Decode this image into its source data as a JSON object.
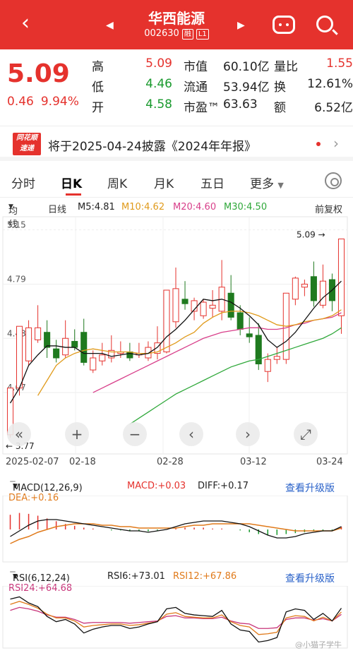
{
  "header": {
    "name": "华西能源",
    "code": "002630",
    "tags": [
      "融",
      "L1"
    ]
  },
  "quote": {
    "price": "5.09",
    "change": "0.46",
    "change_pct": "9.94%",
    "rows": [
      {
        "k1": "高",
        "v1": "5.09",
        "c1": "red",
        "k2": "市值",
        "v2": "60.10亿",
        "k3": "量比",
        "v3": "1.55",
        "c3": "red"
      },
      {
        "k1": "低",
        "v1": "4.46",
        "c1": "green",
        "k2": "流通",
        "v2": "53.94亿",
        "k3": "换",
        "v3": "12.61%",
        "c3": "dark"
      },
      {
        "k1": "开",
        "v1": "4.58",
        "c1": "green",
        "k2": "市盈™",
        "v2": "63.63",
        "k3": "额",
        "v3": "6.52亿",
        "c3": "dark"
      }
    ]
  },
  "notice": {
    "logo_line1": "同花顺",
    "logo_line2": "速递",
    "text": "将于2025-04-24披露《2024年年报》"
  },
  "tabs": [
    "分时",
    "日K",
    "周K",
    "月K",
    "五日",
    "更多"
  ],
  "kinfo": {
    "mode": "均线",
    "period": "日线",
    "ma5": "M5:4.81",
    "ma10": "M10:4.62",
    "ma20": "M20:4.60",
    "ma30": "M30:4.50",
    "adjust": "前复权"
  },
  "chart_data": {
    "type": "candlestick",
    "y_ticks": [
      "5.15",
      "4.79",
      "4.43",
      "4.07"
    ],
    "ylim": [
      3.7,
      5.2
    ],
    "x_labels": [
      "2025-02-07",
      "02-18",
      "02-28",
      "03-12",
      "03-24"
    ],
    "max_label": "5.09",
    "min_label": "3.77",
    "candles": [
      {
        "o": 3.79,
        "c": 4.1,
        "h": 4.1,
        "l": 3.77
      },
      {
        "o": 4.1,
        "c": 4.51,
        "h": 4.51,
        "l": 4.05
      },
      {
        "o": 4.28,
        "c": 4.5,
        "h": 4.55,
        "l": 4.25
      },
      {
        "o": 4.42,
        "c": 4.5,
        "h": 4.65,
        "l": 4.4
      },
      {
        "o": 4.47,
        "c": 4.37,
        "h": 4.55,
        "l": 4.3
      },
      {
        "o": 4.36,
        "c": 4.3,
        "h": 4.42,
        "l": 4.27
      },
      {
        "o": 4.32,
        "c": 4.43,
        "h": 4.55,
        "l": 4.3
      },
      {
        "o": 4.41,
        "c": 4.37,
        "h": 4.49,
        "l": 4.35
      },
      {
        "o": 4.47,
        "c": 4.27,
        "h": 4.56,
        "l": 4.25
      },
      {
        "o": 4.22,
        "c": 4.3,
        "h": 4.35,
        "l": 4.2
      },
      {
        "o": 4.28,
        "c": 4.32,
        "h": 4.4,
        "l": 4.25
      },
      {
        "o": 4.3,
        "c": 4.35,
        "h": 4.45,
        "l": 4.27
      },
      {
        "o": 4.33,
        "c": 4.34,
        "h": 4.41,
        "l": 4.3
      },
      {
        "o": 4.34,
        "c": 4.3,
        "h": 4.4,
        "l": 4.28
      },
      {
        "o": 4.32,
        "c": 4.33,
        "h": 4.4,
        "l": 4.3
      },
      {
        "o": 4.3,
        "c": 4.37,
        "h": 4.41,
        "l": 4.28
      },
      {
        "o": 4.33,
        "c": 4.4,
        "h": 4.51,
        "l": 4.29
      },
      {
        "o": 4.34,
        "c": 4.75,
        "h": 4.75,
        "l": 4.33
      },
      {
        "o": 4.54,
        "c": 4.76,
        "h": 4.9,
        "l": 4.5
      },
      {
        "o": 4.69,
        "c": 4.66,
        "h": 4.81,
        "l": 4.62
      },
      {
        "o": 4.61,
        "c": 4.68,
        "h": 4.7,
        "l": 4.55
      },
      {
        "o": 4.58,
        "c": 4.67,
        "h": 4.69,
        "l": 4.56
      },
      {
        "o": 4.63,
        "c": 4.65,
        "h": 4.75,
        "l": 4.57
      },
      {
        "o": 4.61,
        "c": 4.77,
        "h": 4.95,
        "l": 4.55
      },
      {
        "o": 4.73,
        "c": 4.57,
        "h": 4.85,
        "l": 4.55
      },
      {
        "o": 4.6,
        "c": 4.49,
        "h": 4.65,
        "l": 4.45
      },
      {
        "o": 4.46,
        "c": 4.44,
        "h": 4.57,
        "l": 4.4
      },
      {
        "o": 4.45,
        "c": 4.26,
        "h": 4.53,
        "l": 4.22
      },
      {
        "o": 4.21,
        "c": 4.29,
        "h": 4.33,
        "l": 4.14
      },
      {
        "o": 4.29,
        "c": 4.31,
        "h": 4.37,
        "l": 4.26
      },
      {
        "o": 4.29,
        "c": 4.73,
        "h": 4.73,
        "l": 4.26
      },
      {
        "o": 4.69,
        "c": 4.83,
        "h": 4.84,
        "l": 4.65
      },
      {
        "o": 4.77,
        "c": 4.79,
        "h": 4.82,
        "l": 4.71
      },
      {
        "o": 4.84,
        "c": 4.68,
        "h": 4.94,
        "l": 4.64
      },
      {
        "o": 4.65,
        "c": 4.81,
        "h": 4.92,
        "l": 4.63
      },
      {
        "o": 4.82,
        "c": 4.68,
        "h": 4.86,
        "l": 4.61
      },
      {
        "o": 4.58,
        "c": 5.09,
        "h": 5.09,
        "l": 4.46
      }
    ],
    "ma5": [
      4.0,
      4.1,
      4.25,
      4.32,
      4.38,
      4.38,
      4.37,
      4.37,
      4.33,
      4.33,
      4.33,
      4.31,
      4.32,
      4.33,
      4.32,
      4.33,
      4.37,
      4.44,
      4.49,
      4.55,
      4.62,
      4.69,
      4.68,
      4.69,
      4.67,
      4.63,
      4.58,
      4.52,
      4.42,
      4.37,
      4.41,
      4.47,
      4.55,
      4.63,
      4.7,
      4.75,
      4.81
    ],
    "ma10": [
      null,
      null,
      null,
      4.05,
      4.15,
      4.25,
      4.3,
      4.33,
      4.35,
      4.36,
      4.35,
      4.34,
      4.34,
      4.34,
      4.33,
      4.33,
      4.34,
      4.37,
      4.4,
      4.44,
      4.47,
      4.53,
      4.57,
      4.6,
      4.61,
      4.61,
      4.6,
      4.58,
      4.55,
      4.52,
      4.51,
      4.52,
      4.54,
      4.55,
      4.56,
      4.58,
      4.62
    ],
    "ma20": [
      null,
      null,
      null,
      null,
      null,
      null,
      null,
      null,
      null,
      4.07,
      4.1,
      4.13,
      4.16,
      4.19,
      4.22,
      4.25,
      4.28,
      4.31,
      4.34,
      4.37,
      4.4,
      4.43,
      4.45,
      4.47,
      4.48,
      4.49,
      4.5,
      4.5,
      4.49,
      4.49,
      4.5,
      4.52,
      4.53,
      4.55,
      4.56,
      4.57,
      4.6
    ],
    "ma30": [
      null,
      null,
      null,
      null,
      null,
      null,
      null,
      null,
      null,
      null,
      null,
      null,
      null,
      3.86,
      3.9,
      3.94,
      3.98,
      4.02,
      4.06,
      4.09,
      4.12,
      4.15,
      4.18,
      4.21,
      4.24,
      4.26,
      4.28,
      4.29,
      4.31,
      4.33,
      4.35,
      4.37,
      4.39,
      4.41,
      4.43,
      4.46,
      4.5
    ]
  },
  "controls": [
    "«",
    "+",
    "−",
    "‹",
    "›",
    "⤢"
  ],
  "macd": {
    "label": "MACD(12,26,9)",
    "macd": "MACD:+0.03",
    "diff": "DIFF:+0.17",
    "dea": "DEA:+0.16",
    "upgrade": "查看升级版",
    "hist": [
      0.16,
      0.18,
      0.17,
      0.15,
      0.12,
      0.09,
      0.06,
      0.04,
      0.02,
      0.01,
      0.0,
      -0.01,
      -0.01,
      -0.02,
      -0.02,
      -0.02,
      -0.01,
      0.0,
      0.01,
      0.02,
      0.02,
      0.02,
      0.01,
      0.01,
      0.0,
      -0.01,
      -0.03,
      -0.05,
      -0.06,
      -0.06,
      -0.05,
      -0.04,
      -0.03,
      -0.02,
      -0.02,
      -0.01,
      0.03
    ],
    "diff_line": [
      0.1,
      0.14,
      0.18,
      0.21,
      0.22,
      0.22,
      0.21,
      0.2,
      0.19,
      0.18,
      0.17,
      0.16,
      0.15,
      0.14,
      0.14,
      0.13,
      0.14,
      0.15,
      0.17,
      0.19,
      0.2,
      0.21,
      0.21,
      0.21,
      0.2,
      0.19,
      0.17,
      0.14,
      0.11,
      0.09,
      0.09,
      0.1,
      0.12,
      0.13,
      0.14,
      0.14,
      0.17
    ],
    "dea_line": [
      0.05,
      0.08,
      0.1,
      0.13,
      0.15,
      0.17,
      0.18,
      0.19,
      0.19,
      0.19,
      0.18,
      0.18,
      0.17,
      0.17,
      0.16,
      0.16,
      0.16,
      0.16,
      0.16,
      0.17,
      0.18,
      0.18,
      0.19,
      0.19,
      0.19,
      0.19,
      0.19,
      0.18,
      0.17,
      0.16,
      0.15,
      0.14,
      0.14,
      0.14,
      0.14,
      0.14,
      0.16
    ]
  },
  "rsi": {
    "label": "RSI(6,12,24)",
    "rsi6": "RSI6:+73.01",
    "rsi12": "RSI12:+67.86",
    "rsi24": "RSI24:+64.68",
    "upgrade": "查看升级版",
    "rsi6_line": [
      85,
      88,
      80,
      75,
      62,
      55,
      58,
      52,
      40,
      45,
      48,
      50,
      50,
      46,
      48,
      52,
      55,
      72,
      74,
      66,
      64,
      63,
      62,
      70,
      52,
      44,
      42,
      28,
      30,
      34,
      68,
      72,
      70,
      58,
      66,
      56,
      73
    ],
    "rsi12_line": [
      78,
      82,
      78,
      73,
      65,
      60,
      60,
      56,
      48,
      50,
      51,
      52,
      52,
      50,
      51,
      53,
      55,
      65,
      67,
      62,
      61,
      60,
      60,
      64,
      55,
      50,
      48,
      38,
      39,
      41,
      60,
      63,
      62,
      56,
      61,
      56,
      67.86
    ],
    "rsi24_line": [
      70,
      74,
      72,
      69,
      64,
      61,
      61,
      58,
      53,
      54,
      54,
      54,
      54,
      53,
      54,
      55,
      56,
      62,
      63,
      60,
      60,
      59,
      59,
      61,
      56,
      53,
      52,
      46,
      46,
      47,
      58,
      60,
      60,
      57,
      59,
      56,
      64.68
    ]
  },
  "watermark": "@小猫子学牛"
}
